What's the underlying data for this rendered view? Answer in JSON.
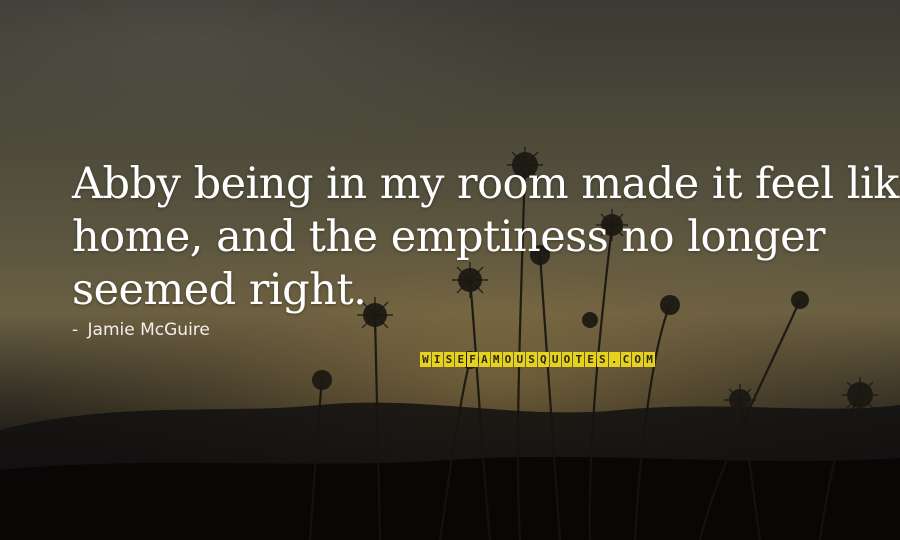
{
  "quote": {
    "lines": [
      "Abby being in my room made it feel like",
      "home, and the emptiness no longer",
      "seemed right."
    ]
  },
  "author": {
    "dash": "-",
    "name": "Jamie McGuire"
  },
  "watermark": {
    "text": "WISEFAMOUSQUOTES.COM",
    "color": "#e6d21c"
  }
}
